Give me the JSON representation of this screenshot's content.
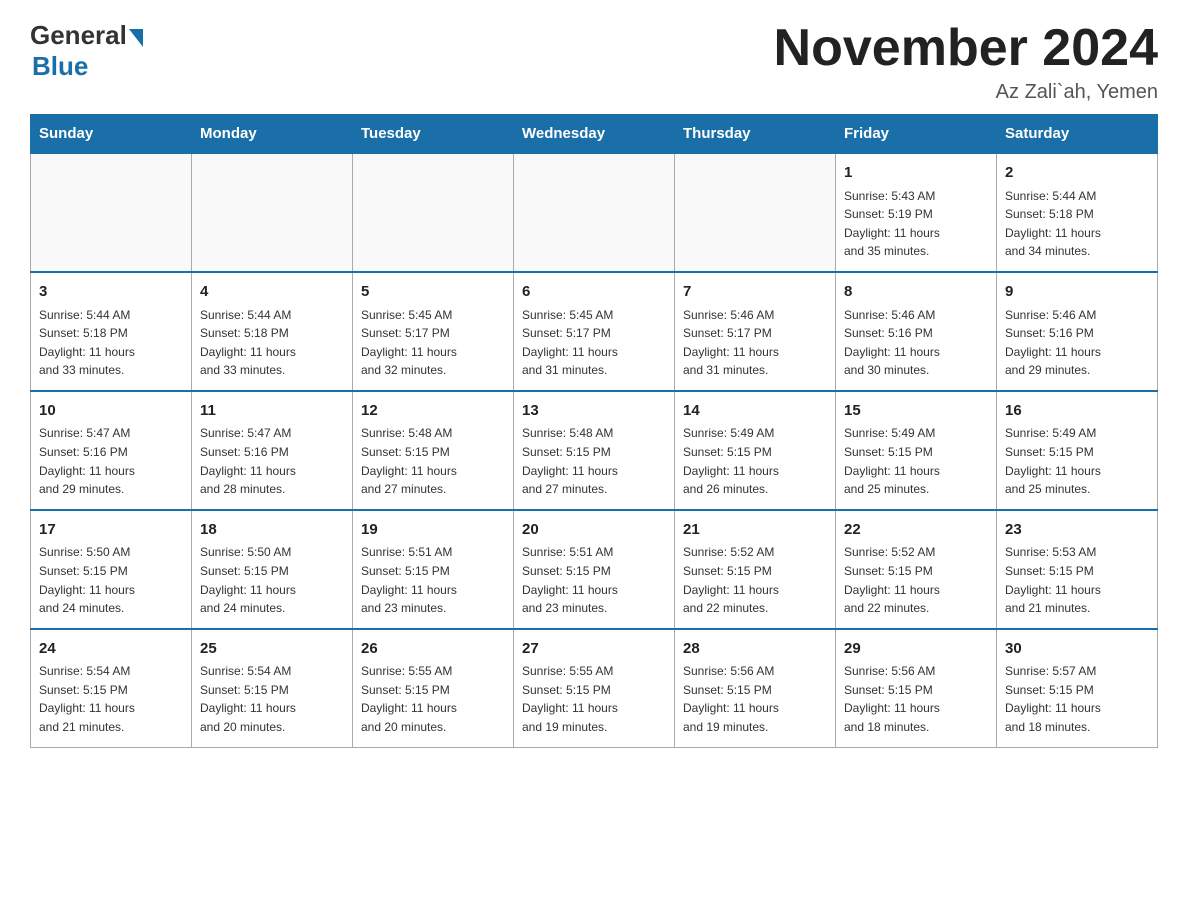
{
  "header": {
    "logo_general": "General",
    "logo_blue": "Blue",
    "month_title": "November 2024",
    "location": "Az Zali`ah, Yemen"
  },
  "weekdays": [
    "Sunday",
    "Monday",
    "Tuesday",
    "Wednesday",
    "Thursday",
    "Friday",
    "Saturday"
  ],
  "weeks": [
    [
      {
        "day": "",
        "info": ""
      },
      {
        "day": "",
        "info": ""
      },
      {
        "day": "",
        "info": ""
      },
      {
        "day": "",
        "info": ""
      },
      {
        "day": "",
        "info": ""
      },
      {
        "day": "1",
        "info": "Sunrise: 5:43 AM\nSunset: 5:19 PM\nDaylight: 11 hours\nand 35 minutes."
      },
      {
        "day": "2",
        "info": "Sunrise: 5:44 AM\nSunset: 5:18 PM\nDaylight: 11 hours\nand 34 minutes."
      }
    ],
    [
      {
        "day": "3",
        "info": "Sunrise: 5:44 AM\nSunset: 5:18 PM\nDaylight: 11 hours\nand 33 minutes."
      },
      {
        "day": "4",
        "info": "Sunrise: 5:44 AM\nSunset: 5:18 PM\nDaylight: 11 hours\nand 33 minutes."
      },
      {
        "day": "5",
        "info": "Sunrise: 5:45 AM\nSunset: 5:17 PM\nDaylight: 11 hours\nand 32 minutes."
      },
      {
        "day": "6",
        "info": "Sunrise: 5:45 AM\nSunset: 5:17 PM\nDaylight: 11 hours\nand 31 minutes."
      },
      {
        "day": "7",
        "info": "Sunrise: 5:46 AM\nSunset: 5:17 PM\nDaylight: 11 hours\nand 31 minutes."
      },
      {
        "day": "8",
        "info": "Sunrise: 5:46 AM\nSunset: 5:16 PM\nDaylight: 11 hours\nand 30 minutes."
      },
      {
        "day": "9",
        "info": "Sunrise: 5:46 AM\nSunset: 5:16 PM\nDaylight: 11 hours\nand 29 minutes."
      }
    ],
    [
      {
        "day": "10",
        "info": "Sunrise: 5:47 AM\nSunset: 5:16 PM\nDaylight: 11 hours\nand 29 minutes."
      },
      {
        "day": "11",
        "info": "Sunrise: 5:47 AM\nSunset: 5:16 PM\nDaylight: 11 hours\nand 28 minutes."
      },
      {
        "day": "12",
        "info": "Sunrise: 5:48 AM\nSunset: 5:15 PM\nDaylight: 11 hours\nand 27 minutes."
      },
      {
        "day": "13",
        "info": "Sunrise: 5:48 AM\nSunset: 5:15 PM\nDaylight: 11 hours\nand 27 minutes."
      },
      {
        "day": "14",
        "info": "Sunrise: 5:49 AM\nSunset: 5:15 PM\nDaylight: 11 hours\nand 26 minutes."
      },
      {
        "day": "15",
        "info": "Sunrise: 5:49 AM\nSunset: 5:15 PM\nDaylight: 11 hours\nand 25 minutes."
      },
      {
        "day": "16",
        "info": "Sunrise: 5:49 AM\nSunset: 5:15 PM\nDaylight: 11 hours\nand 25 minutes."
      }
    ],
    [
      {
        "day": "17",
        "info": "Sunrise: 5:50 AM\nSunset: 5:15 PM\nDaylight: 11 hours\nand 24 minutes."
      },
      {
        "day": "18",
        "info": "Sunrise: 5:50 AM\nSunset: 5:15 PM\nDaylight: 11 hours\nand 24 minutes."
      },
      {
        "day": "19",
        "info": "Sunrise: 5:51 AM\nSunset: 5:15 PM\nDaylight: 11 hours\nand 23 minutes."
      },
      {
        "day": "20",
        "info": "Sunrise: 5:51 AM\nSunset: 5:15 PM\nDaylight: 11 hours\nand 23 minutes."
      },
      {
        "day": "21",
        "info": "Sunrise: 5:52 AM\nSunset: 5:15 PM\nDaylight: 11 hours\nand 22 minutes."
      },
      {
        "day": "22",
        "info": "Sunrise: 5:52 AM\nSunset: 5:15 PM\nDaylight: 11 hours\nand 22 minutes."
      },
      {
        "day": "23",
        "info": "Sunrise: 5:53 AM\nSunset: 5:15 PM\nDaylight: 11 hours\nand 21 minutes."
      }
    ],
    [
      {
        "day": "24",
        "info": "Sunrise: 5:54 AM\nSunset: 5:15 PM\nDaylight: 11 hours\nand 21 minutes."
      },
      {
        "day": "25",
        "info": "Sunrise: 5:54 AM\nSunset: 5:15 PM\nDaylight: 11 hours\nand 20 minutes."
      },
      {
        "day": "26",
        "info": "Sunrise: 5:55 AM\nSunset: 5:15 PM\nDaylight: 11 hours\nand 20 minutes."
      },
      {
        "day": "27",
        "info": "Sunrise: 5:55 AM\nSunset: 5:15 PM\nDaylight: 11 hours\nand 19 minutes."
      },
      {
        "day": "28",
        "info": "Sunrise: 5:56 AM\nSunset: 5:15 PM\nDaylight: 11 hours\nand 19 minutes."
      },
      {
        "day": "29",
        "info": "Sunrise: 5:56 AM\nSunset: 5:15 PM\nDaylight: 11 hours\nand 18 minutes."
      },
      {
        "day": "30",
        "info": "Sunrise: 5:57 AM\nSunset: 5:15 PM\nDaylight: 11 hours\nand 18 minutes."
      }
    ]
  ]
}
